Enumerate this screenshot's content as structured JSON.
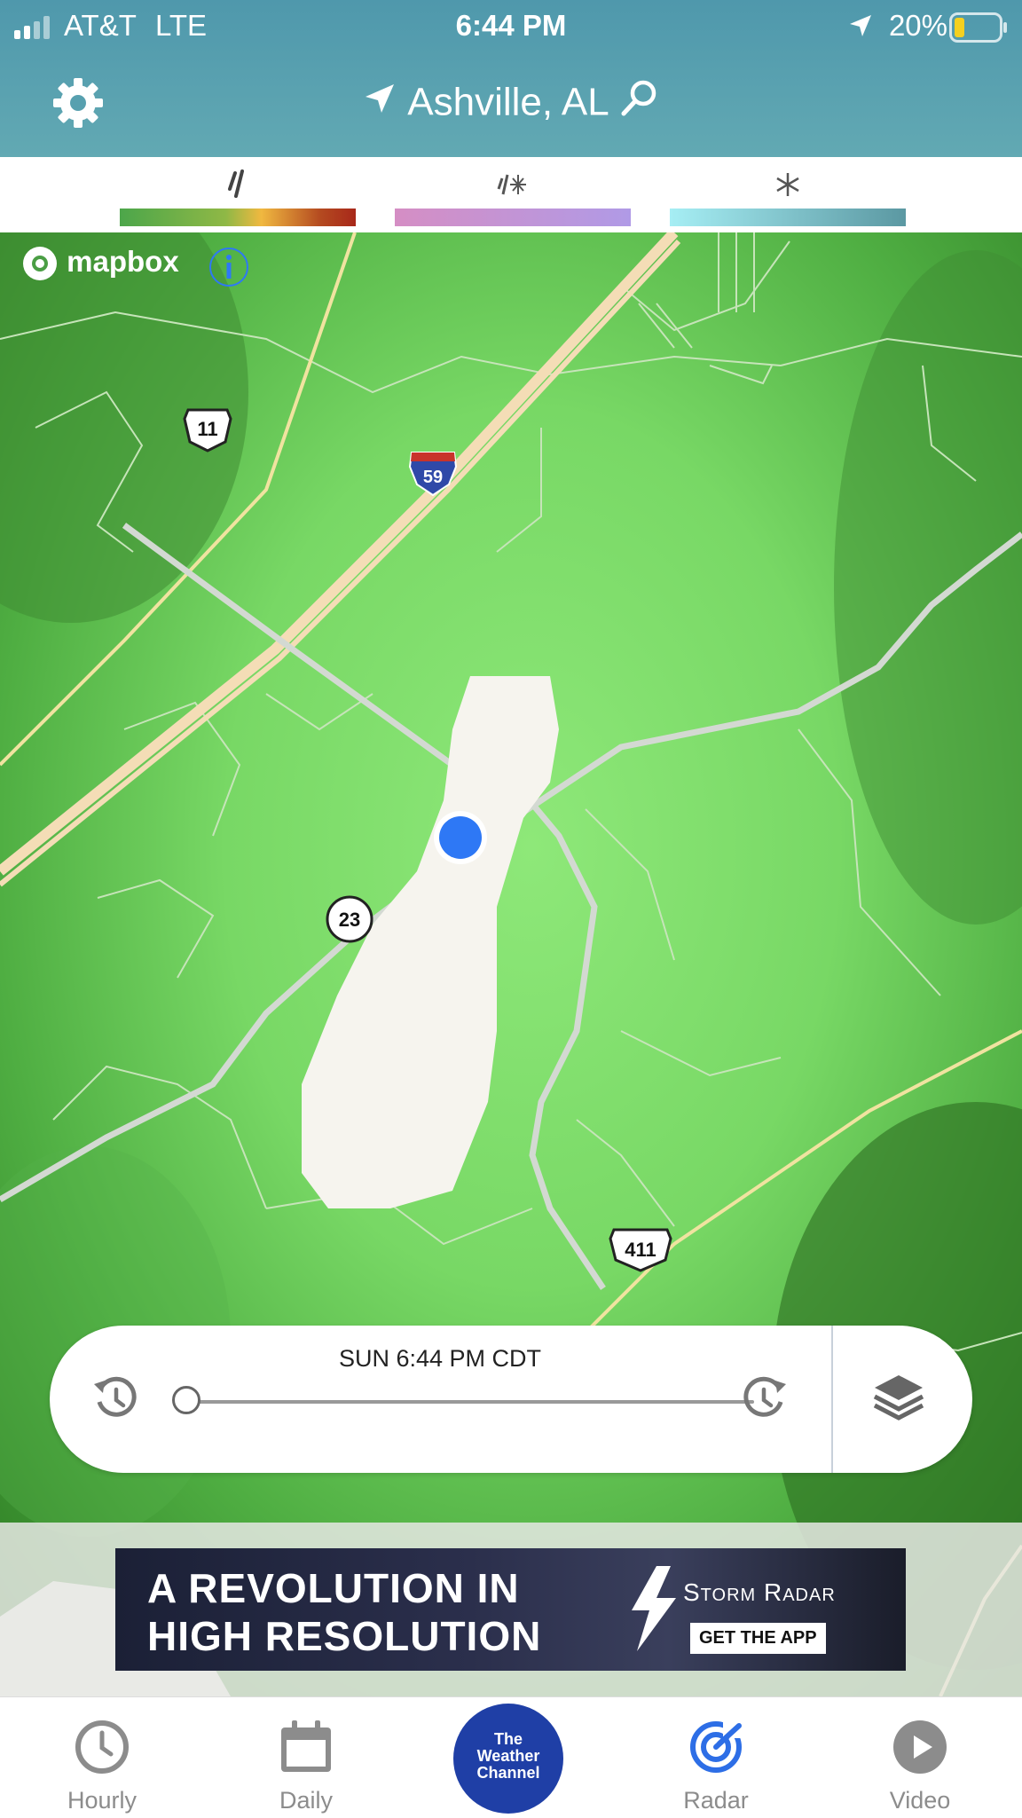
{
  "status_bar": {
    "carrier": "AT&T",
    "network": "LTE",
    "time": "6:44 PM",
    "battery_percent": "20%"
  },
  "header": {
    "location": "Ashville, AL",
    "settings_icon": "gear-icon",
    "search_icon": "search-icon",
    "location_icon": "location-arrow-icon"
  },
  "legend": [
    {
      "name": "rain",
      "icon": "rain-drop-icon",
      "colors": [
        "#4ca64a",
        "#f0b840",
        "#a8281a"
      ]
    },
    {
      "name": "mix",
      "icon": "rain-snow-mix-icon",
      "colors": [
        "#d58ec4",
        "#b09ae6"
      ]
    },
    {
      "name": "snow",
      "icon": "snowflake-icon",
      "colors": [
        "#a6eef4",
        "#5b98a2"
      ]
    }
  ],
  "map": {
    "attribution": "mapbox",
    "route_shields": [
      "11",
      "59",
      "23",
      "411"
    ],
    "colors": {
      "radar_light": "#8ee879",
      "radar_dark": "#2e7d24",
      "snow_area": "#f6f4ee",
      "user_dot": "#2e78f5"
    }
  },
  "timeline": {
    "timestamp": "SUN 6:44 PM CDT",
    "progress": 0,
    "rewind_icon": "history-back-icon",
    "forward_icon": "history-forward-icon",
    "layers_icon": "layers-icon"
  },
  "ad": {
    "headline_line1": "A REVOLUTION IN",
    "headline_line2": "HIGH RESOLUTION",
    "brand": "Storm Radar",
    "cta": "GET THE APP"
  },
  "tabs": [
    {
      "label": "Hourly",
      "icon": "clock-icon",
      "active": false
    },
    {
      "label": "Daily",
      "icon": "calendar-icon",
      "active": false
    },
    {
      "label": "The Weather Channel",
      "icon": "twc-logo",
      "active": false
    },
    {
      "label": "Radar",
      "icon": "radar-icon",
      "active": true
    },
    {
      "label": "Video",
      "icon": "play-icon",
      "active": false
    }
  ],
  "twc_logo": {
    "line1": "The",
    "line2": "Weather",
    "line3": "Channel"
  }
}
